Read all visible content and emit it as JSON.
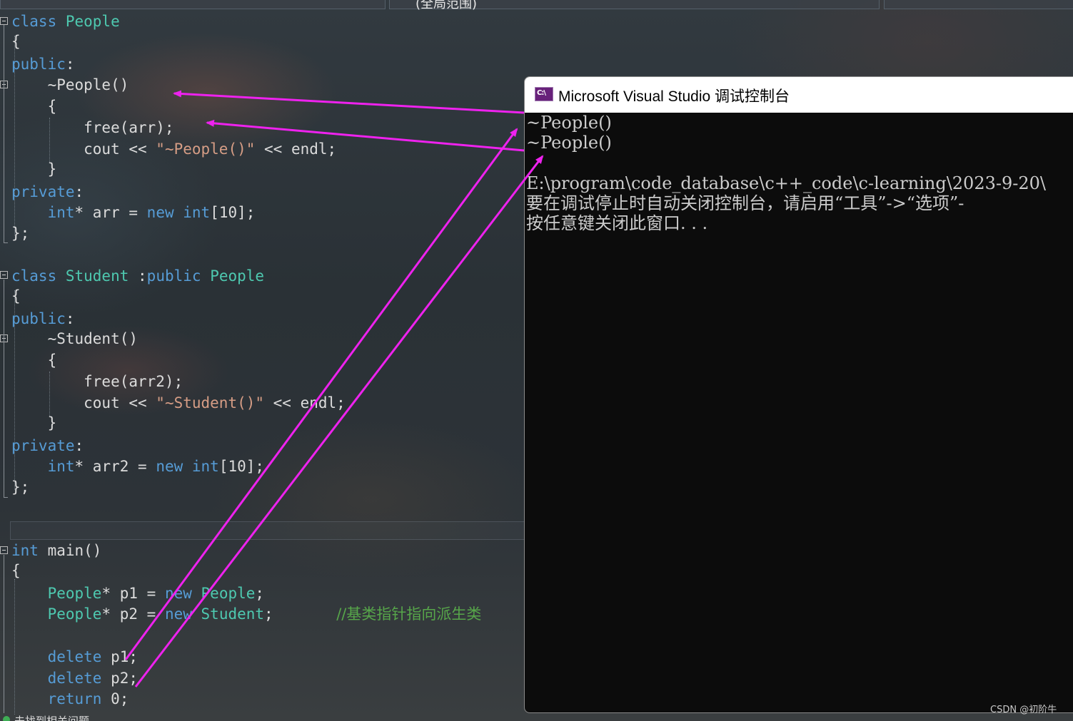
{
  "editor": {
    "top_tab_label": "(全局范围)",
    "lines": [
      {
        "id": "l1",
        "parts": [
          [
            "kw",
            "class "
          ],
          [
            "ty",
            "People"
          ]
        ]
      },
      {
        "id": "l2",
        "parts": [
          [
            "pl",
            "{"
          ]
        ]
      },
      {
        "id": "l3",
        "parts": [
          [
            "kw",
            "public"
          ],
          [
            "pl",
            ":"
          ]
        ]
      },
      {
        "id": "l4",
        "parts": [
          [
            "pl",
            "    ~People()"
          ]
        ]
      },
      {
        "id": "l5",
        "parts": [
          [
            "pl",
            "    {"
          ]
        ]
      },
      {
        "id": "l6",
        "parts": [
          [
            "pl",
            "        free(arr);"
          ]
        ]
      },
      {
        "id": "l7",
        "parts": [
          [
            "pl",
            "        cout << "
          ],
          [
            "st",
            "\"~People()\""
          ],
          [
            "pl",
            " << endl;"
          ]
        ]
      },
      {
        "id": "l8",
        "parts": [
          [
            "pl",
            "    }"
          ]
        ]
      },
      {
        "id": "l9",
        "parts": [
          [
            "kw",
            "private"
          ],
          [
            "pl",
            ":"
          ]
        ]
      },
      {
        "id": "l10",
        "parts": [
          [
            "pl",
            "    "
          ],
          [
            "kw",
            "int"
          ],
          [
            "pl",
            "* arr = "
          ],
          [
            "kw",
            "new "
          ],
          [
            "kw",
            "int"
          ],
          [
            "pl",
            "[10];"
          ]
        ]
      },
      {
        "id": "l11",
        "parts": [
          [
            "pl",
            "};"
          ]
        ]
      },
      {
        "id": "l12",
        "parts": [
          [
            "kw",
            "class "
          ],
          [
            "ty",
            "Student "
          ],
          [
            "pl",
            ":"
          ],
          [
            "kw",
            "public "
          ],
          [
            "ty",
            "People"
          ]
        ]
      },
      {
        "id": "l13",
        "parts": [
          [
            "pl",
            "{"
          ]
        ]
      },
      {
        "id": "l14",
        "parts": [
          [
            "kw",
            "public"
          ],
          [
            "pl",
            ":"
          ]
        ]
      },
      {
        "id": "l15",
        "parts": [
          [
            "pl",
            "    ~Student()"
          ]
        ]
      },
      {
        "id": "l16",
        "parts": [
          [
            "pl",
            "    {"
          ]
        ]
      },
      {
        "id": "l17",
        "parts": [
          [
            "pl",
            "        free(arr2);"
          ]
        ]
      },
      {
        "id": "l18",
        "parts": [
          [
            "pl",
            "        cout << "
          ],
          [
            "st",
            "\"~Student()\""
          ],
          [
            "pl",
            " << endl;"
          ]
        ]
      },
      {
        "id": "l19",
        "parts": [
          [
            "pl",
            "    }"
          ]
        ]
      },
      {
        "id": "l20",
        "parts": [
          [
            "kw",
            "private"
          ],
          [
            "pl",
            ":"
          ]
        ]
      },
      {
        "id": "l21",
        "parts": [
          [
            "pl",
            "    "
          ],
          [
            "kw",
            "int"
          ],
          [
            "pl",
            "* arr2 = "
          ],
          [
            "kw",
            "new "
          ],
          [
            "kw",
            "int"
          ],
          [
            "pl",
            "[10];"
          ]
        ]
      },
      {
        "id": "l22",
        "parts": [
          [
            "pl",
            "};"
          ]
        ]
      },
      {
        "id": "l23",
        "parts": [
          [
            "kw",
            "int "
          ],
          [
            "pl",
            "main()"
          ]
        ]
      },
      {
        "id": "l24",
        "parts": [
          [
            "pl",
            "{"
          ]
        ]
      },
      {
        "id": "l25",
        "parts": [
          [
            "pl",
            "    "
          ],
          [
            "ty",
            "People"
          ],
          [
            "pl",
            "* p1 = "
          ],
          [
            "kw",
            "new "
          ],
          [
            "ty",
            "People"
          ],
          [
            "pl",
            ";"
          ]
        ]
      },
      {
        "id": "l26",
        "parts": [
          [
            "pl",
            "    "
          ],
          [
            "ty",
            "People"
          ],
          [
            "pl",
            "* p2 = "
          ],
          [
            "kw",
            "new "
          ],
          [
            "ty",
            "Student"
          ],
          [
            "pl",
            ";       "
          ],
          [
            "cm",
            "//基类指针指向派生类"
          ]
        ]
      },
      {
        "id": "l27",
        "parts": [
          [
            "pl",
            ""
          ]
        ]
      },
      {
        "id": "l28",
        "parts": [
          [
            "pl",
            "    "
          ],
          [
            "kw",
            "delete "
          ],
          [
            "pl",
            "p1;"
          ]
        ]
      },
      {
        "id": "l29",
        "parts": [
          [
            "pl",
            "    "
          ],
          [
            "kw",
            "delete "
          ],
          [
            "pl",
            "p2;"
          ]
        ]
      },
      {
        "id": "l30",
        "parts": [
          [
            "pl",
            "    "
          ],
          [
            "kw",
            "return "
          ],
          [
            "pl",
            "0;"
          ]
        ]
      }
    ],
    "status_text": "未找到相关问题"
  },
  "console": {
    "title": "Microsoft Visual Studio 调试控制台",
    "icon_label": "C:\\",
    "icon": "terminal-icon",
    "output": [
      "~People()",
      "~People()",
      "",
      "E:\\program\\code_database\\c++_code\\c-learning\\2023-9-20\\",
      "要在调试停止时自动关闭控制台，请启用“工具”->“选项”-",
      "按任意键关闭此窗口. . ."
    ]
  },
  "annotations": {
    "arrow_color": "#ee22ee"
  },
  "watermark": "CSDN @初阶牛"
}
